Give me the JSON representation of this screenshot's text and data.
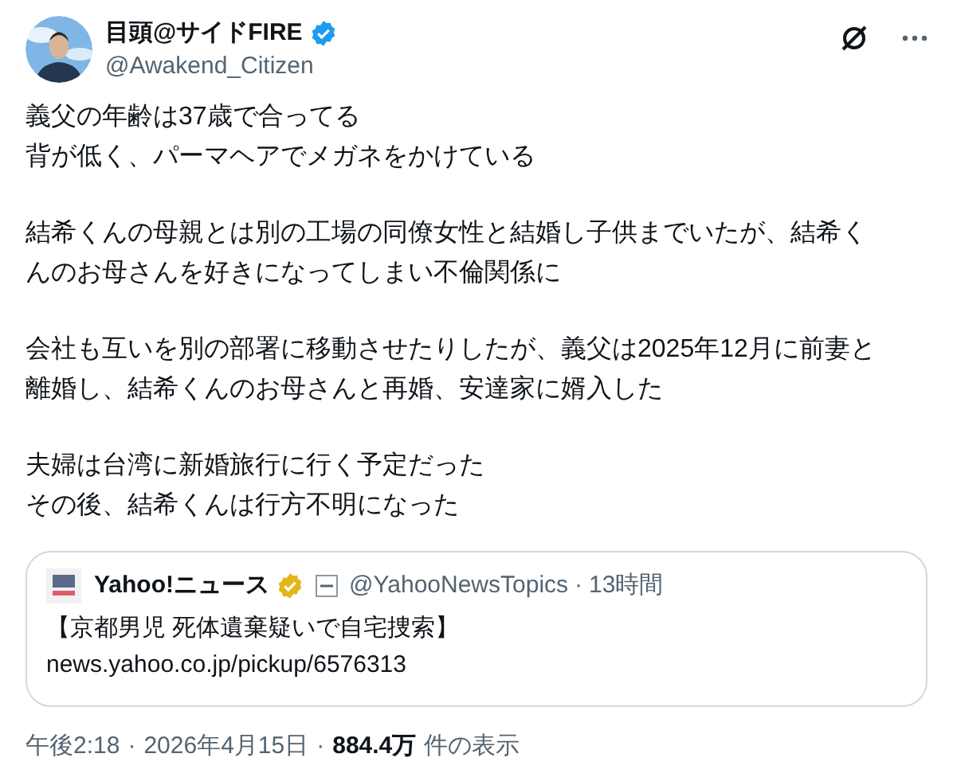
{
  "author": {
    "name": "目頭@サイドFIRE",
    "verified": true,
    "handle": "@Awakend_Citizen"
  },
  "body": [
    [
      "義父の年齢は37歳で合ってる",
      "背が低く、パーマヘアでメガネをかけている"
    ],
    [
      "結希くんの母親とは別の工場の同僚女性と結婚し子供までいたが、結希く",
      "んのお母さんを好きになってしまい不倫関係に"
    ],
    [
      "会社も互いを別の部署に移動させたりしたが、義父は2025年12月に前妻と",
      "離婚し、結希くんのお母さんと再婚、安達家に婿入した"
    ],
    [
      "夫婦は台湾に新婚旅行に行く予定だった",
      "その後、結希くんは行方不明になった"
    ]
  ],
  "quote": {
    "name": "Yahoo!ニュース",
    "verified": true,
    "handle": "@YahooNewsTopics",
    "separator": "·",
    "time": "13時間",
    "lines": [
      "【京都男児 死体遺棄疑いで自宅捜索】",
      "news.yahoo.co.jp/pickup/6576313"
    ]
  },
  "footer": {
    "time": "午後2:18",
    "separator_1": "·",
    "date": "2026年4月15日",
    "separator_2": "·",
    "views": "884.4万",
    "views_label": "件の表示"
  }
}
